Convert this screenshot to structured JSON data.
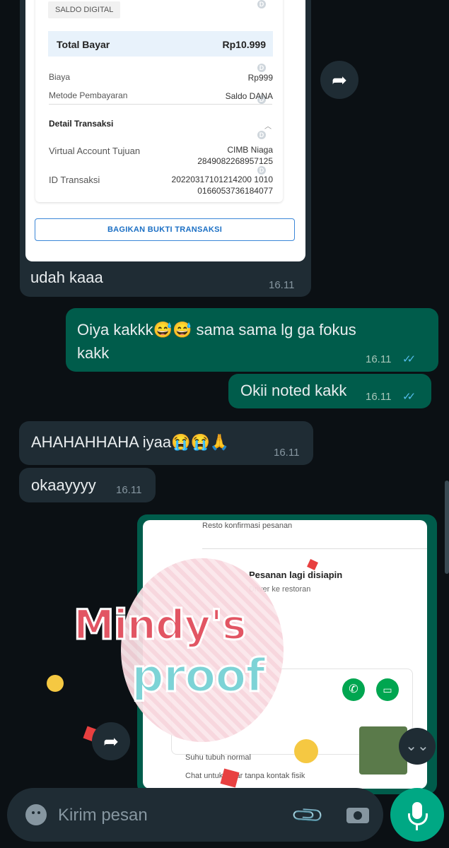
{
  "receipt": {
    "badge": "SALDO DIGITAL",
    "total_label": "Total Bayar",
    "total_value": "Rp10.999",
    "fee_label": "Biaya",
    "fee_value": "Rp999",
    "method_label": "Metode Pembayaran",
    "method_value": "Saldo DANA",
    "detail_title": "Detail Transaksi",
    "va_label": "Virtual Account Tujuan",
    "va_bank": "CIMB Niaga",
    "va_number": "2849082268957125",
    "id_label": "ID Transaksi",
    "id_line1": "20220317101214200 1010",
    "id_line2": "0166053736184077",
    "share_button": "BAGIKAN BUKTI TRANSAKSI",
    "edge_glyph": "D"
  },
  "messages": {
    "m1_caption": "udah kaaa",
    "m1_time": "16.11",
    "m2_line1": "Oiya kakkk😅😅 sama sama lg ga fokus",
    "m2_line2": "kakk",
    "m2_time": "16.11",
    "m3_text": "Okii noted kakk",
    "m3_time": "16.11",
    "m4_text": "AHAHAHHAHA iyaa😭😭🙏",
    "m4_time": "16.11",
    "m5_text": "okaayyyy",
    "m5_time": "16.11",
    "ticks": "✓✓"
  },
  "shared_image": {
    "line1": "Resto konfirmasi pesanan",
    "line2": "Pesanan lagi disiapin",
    "line3": "Driver ke restoran",
    "line4": "Suhu tubuh normal",
    "line5": "Chat untuk antar tanpa kontak fisik"
  },
  "watermark": {
    "word1": "Mindy's",
    "word2": "proof"
  },
  "composer": {
    "placeholder": "Kirim pesan"
  },
  "icons": {
    "forward": "➦",
    "scroll_down": "⌄⌄",
    "attach": "📎"
  },
  "colors": {
    "background": "#0b1014",
    "incoming": "#1f2c34",
    "outgoing": "#005c4b",
    "accent": "#00a884",
    "read_ticks": "#53bdeb"
  }
}
